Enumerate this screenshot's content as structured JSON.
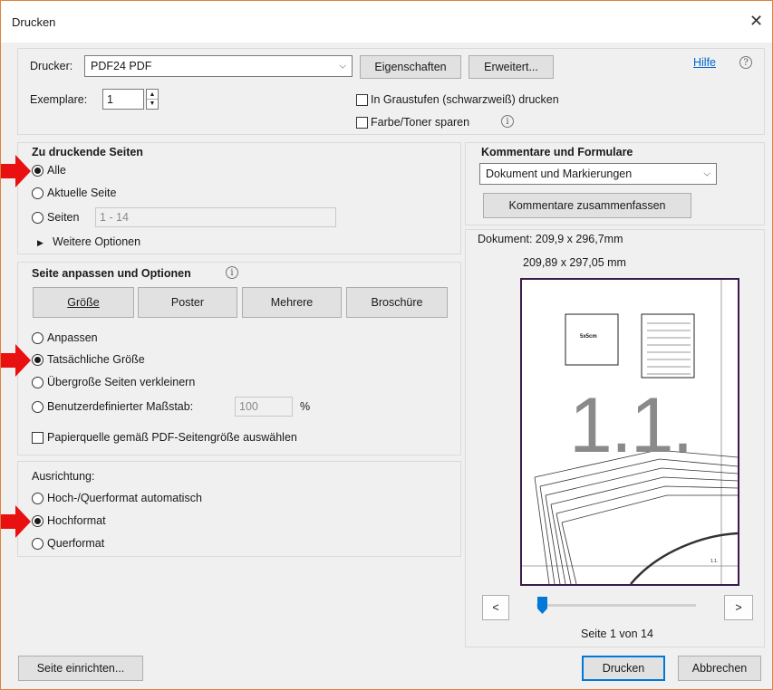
{
  "window": {
    "title": "Drucken",
    "close_glyph": "✕"
  },
  "printer": {
    "label": "Drucker:",
    "value": "PDF24 PDF",
    "properties_button": "Eigenschaften",
    "advanced_button": "Erweitert...",
    "help_link": "Hilfe",
    "help_icon": "?"
  },
  "copies": {
    "label": "Exemplare:",
    "value": "1"
  },
  "options": {
    "grayscale": {
      "label": "In Graustufen (schwarzweiß) drucken",
      "checked": false
    },
    "save_toner": {
      "label": "Farbe/Toner sparen",
      "checked": false
    },
    "info_glyph": "i"
  },
  "pages": {
    "heading": "Zu druckende Seiten",
    "all": "Alle",
    "current": "Aktuelle Seite",
    "range_label": "Seiten",
    "range_value": "1 - 14",
    "more": "Weitere Optionen",
    "selected": "all"
  },
  "sizing": {
    "heading": "Seite anpassen und Optionen",
    "buttons": [
      "Größe",
      "Poster",
      "Mehrere",
      "Broschüre"
    ],
    "fit": "Anpassen",
    "actual": "Tatsächliche Größe",
    "shrink": "Übergroße Seiten verkleinern",
    "custom_label": "Benutzerdefinierter Maßstab:",
    "custom_value": "100",
    "percent": "%",
    "paper_source": "Papierquelle gemäß PDF-Seitengröße auswählen",
    "selected": "actual"
  },
  "orientation": {
    "heading": "Ausrichtung:",
    "auto": "Hoch-/Querformat automatisch",
    "portrait": "Hochformat",
    "landscape": "Querformat",
    "selected": "portrait"
  },
  "comments": {
    "heading": "Kommentare und Formulare",
    "value": "Dokument und Markierungen",
    "summarize_button": "Kommentare zusammenfassen"
  },
  "preview": {
    "doc_size": "Dokument: 209,9 x 296,7mm",
    "paper_size": "209,89 x 297,05 mm",
    "box_label": "5x5cm",
    "big_label": "1.1.",
    "corner_label": "1.1.",
    "prev": "<",
    "next": ">",
    "page_text": "Seite 1 von 14",
    "slider_fraction": 0.0
  },
  "footer": {
    "setup_button": "Seite einrichten...",
    "print_button": "Drucken",
    "cancel_button": "Abbrechen"
  },
  "colors": {
    "accent": "#0078d7",
    "annotation_arrow": "#e81010",
    "page_frame": "#3a1a4a"
  }
}
